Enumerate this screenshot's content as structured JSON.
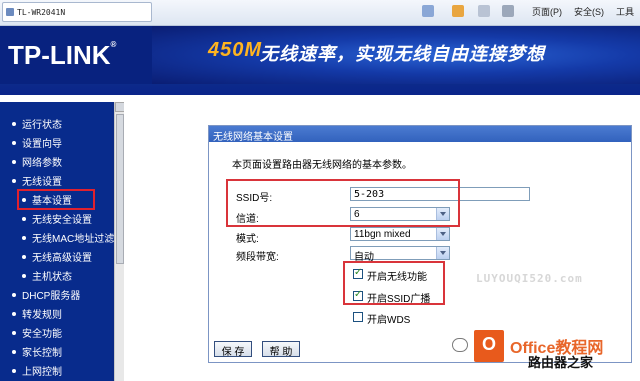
{
  "browser": {
    "tab_title": "TL-WR2041N",
    "toolbar": {
      "page_menu": "页面(P)",
      "safety_menu": "安全(S)",
      "tools_menu": "工具"
    }
  },
  "banner": {
    "logo": "TP-LINK",
    "slogan_speed": "450M",
    "slogan_text": "无线速率，实现无线自由连接梦想"
  },
  "nav": {
    "items": [
      {
        "label": "运行状态"
      },
      {
        "label": "设置向导"
      },
      {
        "label": "网络参数"
      },
      {
        "label": "无线设置"
      },
      {
        "label": "基本设置"
      },
      {
        "label": "无线安全设置"
      },
      {
        "label": "无线MAC地址过滤"
      },
      {
        "label": "无线高级设置"
      },
      {
        "label": "主机状态"
      },
      {
        "label": "DHCP服务器"
      },
      {
        "label": "转发规则"
      },
      {
        "label": "安全功能"
      },
      {
        "label": "家长控制"
      },
      {
        "label": "上网控制"
      }
    ]
  },
  "panel": {
    "title": "无线网络基本设置",
    "description": "本页面设置路由器无线网络的基本参数。",
    "ssid_label": "SSID号:",
    "ssid_value": "5-203",
    "channel_label": "信道:",
    "channel_value": "6",
    "mode_label": "模式:",
    "mode_value": "11bgn mixed",
    "bandwidth_label": "频段带宽:",
    "bandwidth_value": "自动",
    "enable_wireless_label": "开启无线功能",
    "enable_wireless_checked": true,
    "enable_ssid_broadcast_label": "开启SSID广播",
    "enable_ssid_broadcast_checked": true,
    "enable_wds_label": "开启WDS",
    "enable_wds_checked": false,
    "save_button": "保 存",
    "help_button": "帮 助"
  },
  "watermark": {
    "site": "LUYOUQI520.com",
    "office_logo_letter": "O",
    "office_text": "Office教程网",
    "office_sub": "路由器之家"
  },
  "colors": {
    "banner_bg": "#0a2a9e",
    "nav_bg": "#082b8c",
    "panel_header": "#3262bd",
    "highlight_red": "#d9343a",
    "slogan_accent": "#ffb420"
  }
}
